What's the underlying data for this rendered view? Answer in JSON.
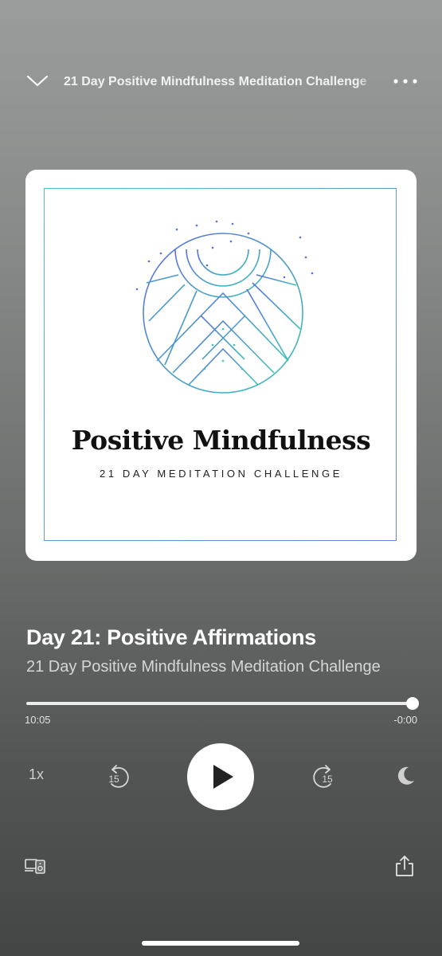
{
  "header": {
    "title": "21 Day Positive Mindfulness Meditation Challenge",
    "collapse_icon": "chevron-down-icon",
    "more_icon": "more-dots-icon"
  },
  "artwork": {
    "title": "Positive Mindfulness",
    "subtitle": "21 DAY MEDITATION CHALLENGE",
    "colors": {
      "teal": "#4bc0c8",
      "blue": "#5a6fe0"
    }
  },
  "episode": {
    "title": "Day 21: Positive Affirmations",
    "show": "21 Day Positive Mindfulness Meditation Challenge"
  },
  "progress": {
    "elapsed": "10:05",
    "remaining": "-0:00",
    "fraction": 1.0
  },
  "controls": {
    "speed": "1x",
    "rewind_seconds": "15",
    "forward_seconds": "15",
    "play_icon": "play-icon",
    "sleep_icon": "moon-icon"
  },
  "bottom": {
    "devices_icon": "devices-icon",
    "share_icon": "share-icon"
  }
}
